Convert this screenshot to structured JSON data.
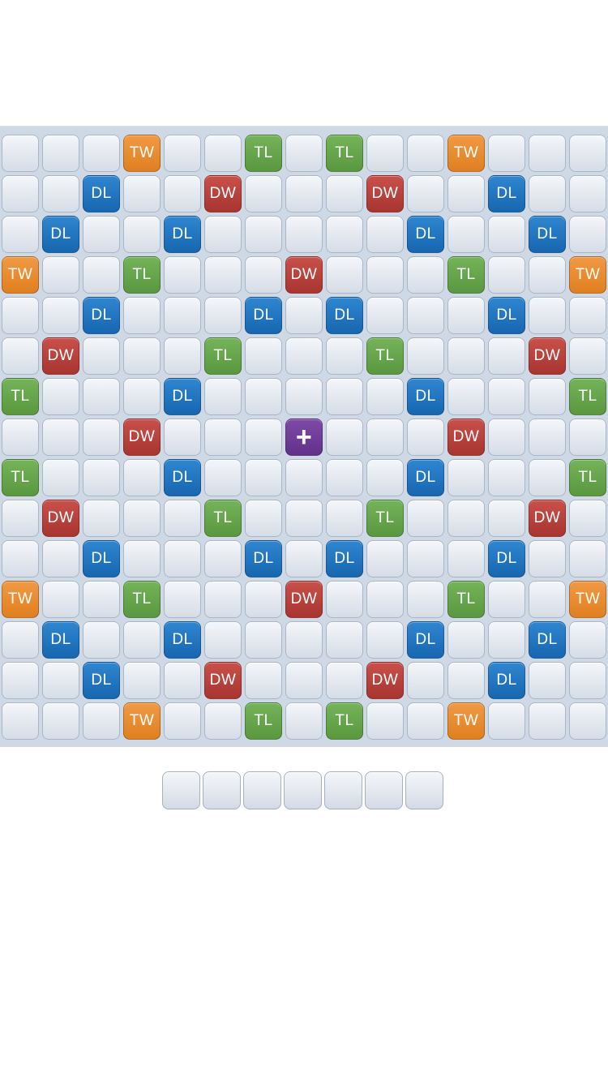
{
  "board": {
    "size": 15,
    "legend": {
      "TW": "triple-word",
      "TL": "triple-letter",
      "DL": "double-letter",
      "DW": "double-word",
      "*": "center-star"
    },
    "center_glyph": "+",
    "colors": {
      "TW": "#e58a2e",
      "TL": "#67a64d",
      "DL": "#1f74c0",
      "DW": "#b8433e",
      "star": "#6e3c96",
      "blank": "#e3e8ef",
      "board_bg": "#cfd9e6"
    },
    "rows": [
      [
        "",
        "",
        "",
        "TW",
        "",
        "",
        "TL",
        "",
        "TL",
        "",
        "",
        "TW",
        "",
        "",
        ""
      ],
      [
        "",
        "",
        "DL",
        "",
        "",
        "DW",
        "",
        "",
        "",
        "DW",
        "",
        "",
        "DL",
        "",
        ""
      ],
      [
        "",
        "DL",
        "",
        "",
        "DL",
        "",
        "",
        "",
        "",
        "",
        "DL",
        "",
        "",
        "DL",
        ""
      ],
      [
        "TW",
        "",
        "",
        "TL",
        "",
        "",
        "",
        "DW",
        "",
        "",
        "",
        "TL",
        "",
        "",
        "TW"
      ],
      [
        "",
        "",
        "DL",
        "",
        "",
        "",
        "DL",
        "",
        "DL",
        "",
        "",
        "",
        "DL",
        "",
        ""
      ],
      [
        "",
        "DW",
        "",
        "",
        "",
        "TL",
        "",
        "",
        "",
        "TL",
        "",
        "",
        "",
        "DW",
        ""
      ],
      [
        "TL",
        "",
        "",
        "",
        "DL",
        "",
        "",
        "",
        "",
        "",
        "DL",
        "",
        "",
        "",
        "TL"
      ],
      [
        "",
        "",
        "",
        "DW",
        "",
        "",
        "",
        "*",
        "",
        "",
        "",
        "DW",
        "",
        "",
        ""
      ],
      [
        "TL",
        "",
        "",
        "",
        "DL",
        "",
        "",
        "",
        "",
        "",
        "DL",
        "",
        "",
        "",
        "TL"
      ],
      [
        "",
        "DW",
        "",
        "",
        "",
        "TL",
        "",
        "",
        "",
        "TL",
        "",
        "",
        "",
        "DW",
        ""
      ],
      [
        "",
        "",
        "DL",
        "",
        "",
        "",
        "DL",
        "",
        "DL",
        "",
        "",
        "",
        "DL",
        "",
        ""
      ],
      [
        "TW",
        "",
        "",
        "TL",
        "",
        "",
        "",
        "DW",
        "",
        "",
        "",
        "TL",
        "",
        "",
        "TW"
      ],
      [
        "",
        "DL",
        "",
        "",
        "DL",
        "",
        "",
        "",
        "",
        "",
        "DL",
        "",
        "",
        "DL",
        ""
      ],
      [
        "",
        "",
        "DL",
        "",
        "",
        "DW",
        "",
        "",
        "",
        "DW",
        "",
        "",
        "DL",
        "",
        ""
      ],
      [
        "",
        "",
        "",
        "TW",
        "",
        "",
        "TL",
        "",
        "TL",
        "",
        "",
        "TW",
        "",
        "",
        ""
      ]
    ]
  },
  "rack": {
    "slots": [
      "",
      "",
      "",
      "",
      "",
      "",
      ""
    ]
  }
}
